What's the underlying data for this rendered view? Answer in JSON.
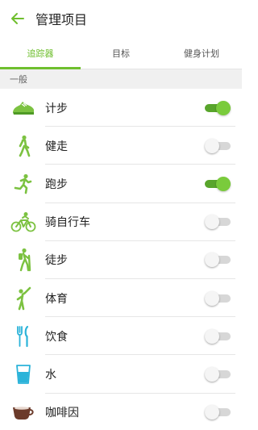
{
  "header": {
    "title": "管理项目"
  },
  "tabs": [
    {
      "label": "追踪器",
      "active": true
    },
    {
      "label": "目标",
      "active": false
    },
    {
      "label": "健身计划",
      "active": false
    }
  ],
  "section": {
    "label": "一般"
  },
  "items": [
    {
      "label": "计步",
      "icon": "shoe-icon",
      "on": true
    },
    {
      "label": "健走",
      "icon": "walking-person-icon",
      "on": false
    },
    {
      "label": "跑步",
      "icon": "running-person-icon",
      "on": true
    },
    {
      "label": "骑自行车",
      "icon": "cyclist-icon",
      "on": false
    },
    {
      "label": "徒步",
      "icon": "hiker-icon",
      "on": false
    },
    {
      "label": "体育",
      "icon": "stretching-person-icon",
      "on": false
    },
    {
      "label": "饮食",
      "icon": "fork-knife-icon",
      "on": false
    },
    {
      "label": "水",
      "icon": "water-glass-icon",
      "on": false
    },
    {
      "label": "咖啡因",
      "icon": "coffee-cup-icon",
      "on": false
    }
  ],
  "colors": {
    "accent": "#6fbf2e",
    "switch_on": "#59a52c",
    "water": "#2bb3d9",
    "coffee": "#6b3a2a"
  }
}
